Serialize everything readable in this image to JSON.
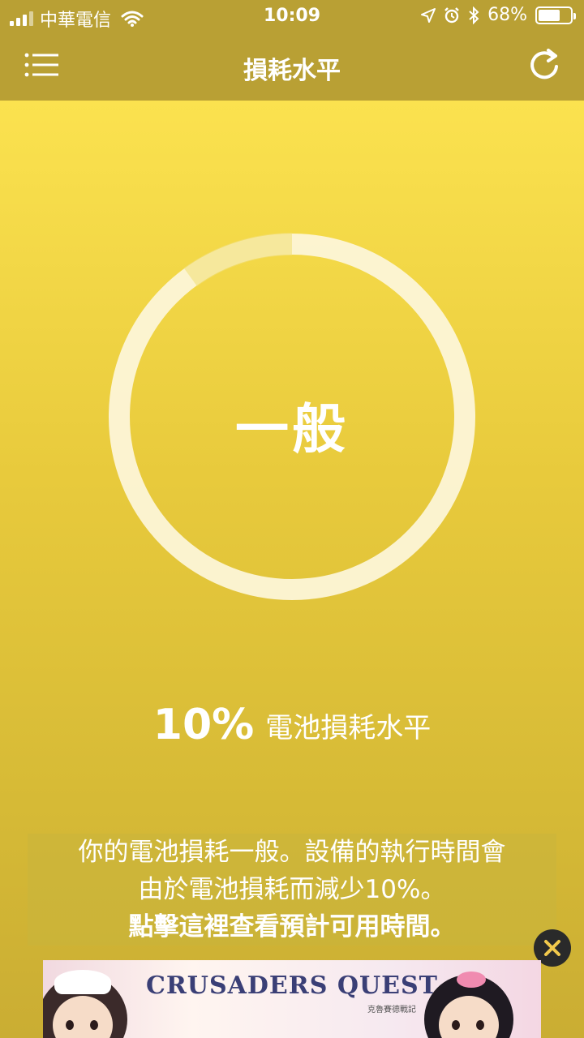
{
  "status_bar": {
    "carrier": "中華電信",
    "time": "10:09",
    "battery": "68%",
    "battery_level": 0.68
  },
  "nav": {
    "title": "損耗水平",
    "menu_icon": "list-menu-icon",
    "refresh_icon": "refresh-icon"
  },
  "gauge": {
    "label": "一般",
    "wear_fraction": 0.1,
    "ring_color": "#fdf6dc"
  },
  "level": {
    "percent": "10%",
    "text": "電池損耗水平"
  },
  "info": {
    "line1": "你的電池損耗一般。設備的執行時間會",
    "line2": "由於電池損耗而減少10%。",
    "line3": "點擊這裡查看預計可用時間。"
  },
  "ad": {
    "title": "CRUSADERS QUEST",
    "subtitle": "克魯賽德戰記"
  },
  "colors": {
    "nav_bg": "#b9a034",
    "main_top": "#fbe24f",
    "main_bottom": "#caad33"
  }
}
